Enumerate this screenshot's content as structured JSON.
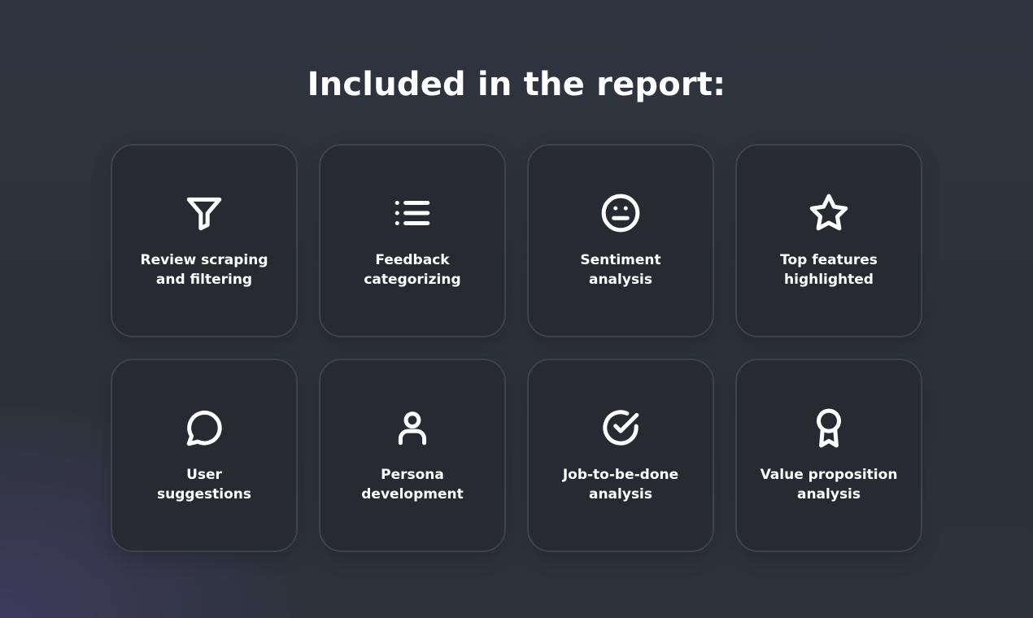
{
  "title": "Included in the report:",
  "cards": [
    {
      "label": "Review scraping\nand filtering",
      "icon": "filter-icon"
    },
    {
      "label": "Feedback\ncategorizing",
      "icon": "list-icon"
    },
    {
      "label": "Sentiment\nanalysis",
      "icon": "neutral-face-icon"
    },
    {
      "label": "Top features\nhighlighted",
      "icon": "star-icon"
    },
    {
      "label": "User\nsuggestions",
      "icon": "chat-bubble-icon"
    },
    {
      "label": "Persona\ndevelopment",
      "icon": "user-icon"
    },
    {
      "label": "Job-to-be-done\nanalysis",
      "icon": "check-circle-icon"
    },
    {
      "label": "Value proposition\nanalysis",
      "icon": "award-ribbon-icon"
    }
  ]
}
